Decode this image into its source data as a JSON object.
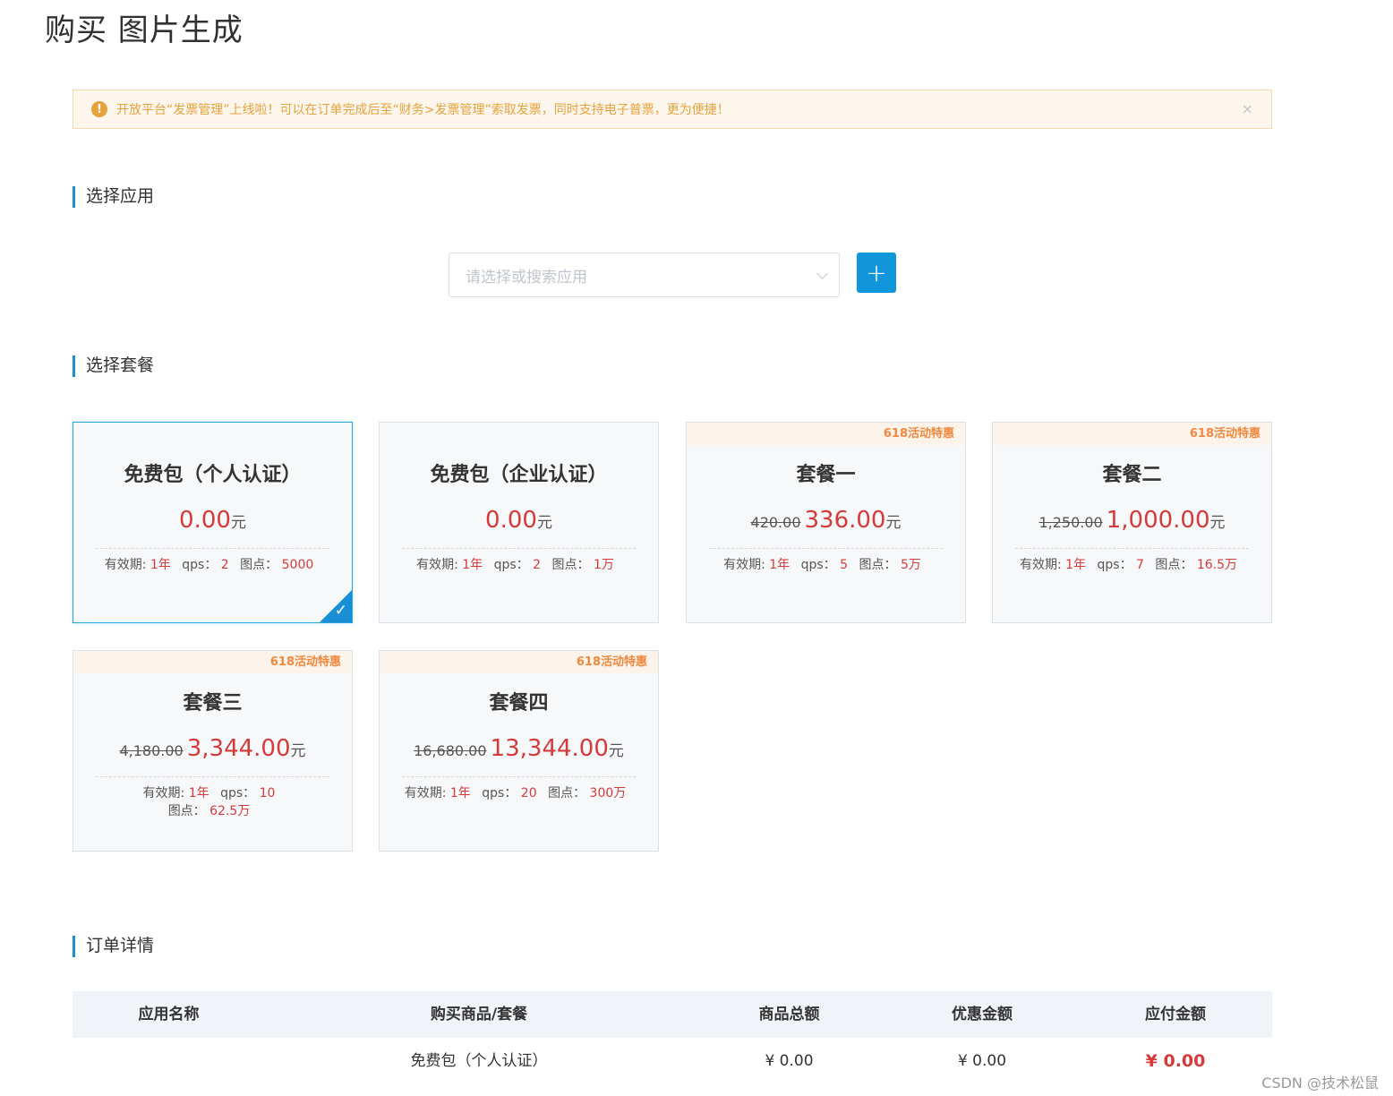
{
  "page": {
    "title": "购买 图片生成"
  },
  "alert": {
    "icon": "exclamation-circle-icon",
    "text": "开放平台“发票管理”上线啦！可以在订单完成后至“财务>发票管理”索取发票，同时支持电子普票，更为便捷！",
    "close": "×"
  },
  "sections": {
    "app": "选择应用",
    "package": "选择套餐",
    "order": "订单详情"
  },
  "app_select": {
    "placeholder": "请选择或搜索应用",
    "add_button": "+"
  },
  "labels": {
    "validity": "有效期:",
    "qps": "qps：",
    "points": "图点：",
    "yuan": "元"
  },
  "packages": [
    {
      "name": "免费包（个人认证）",
      "badge": "",
      "old_price": "",
      "price": "0.00",
      "validity": "1年",
      "qps": "2",
      "points": "5000",
      "selected": true
    },
    {
      "name": "免费包（企业认证）",
      "badge": "",
      "old_price": "",
      "price": "0.00",
      "validity": "1年",
      "qps": "2",
      "points": "1万",
      "selected": false
    },
    {
      "name": "套餐一",
      "badge": "618活动特惠",
      "old_price": "420.00",
      "price": "336.00",
      "validity": "1年",
      "qps": "5",
      "points": "5万",
      "selected": false
    },
    {
      "name": "套餐二",
      "badge": "618活动特惠",
      "old_price": "1,250.00",
      "price": "1,000.00",
      "validity": "1年",
      "qps": "7",
      "points": "16.5万",
      "selected": false
    },
    {
      "name": "套餐三",
      "badge": "618活动特惠",
      "old_price": "4,180.00",
      "price": "3,344.00",
      "validity": "1年",
      "qps": "10",
      "points": "62.5万",
      "selected": false
    },
    {
      "name": "套餐四",
      "badge": "618活动特惠",
      "old_price": "16,680.00",
      "price": "13,344.00",
      "validity": "1年",
      "qps": "20",
      "points": "300万",
      "selected": false
    }
  ],
  "order_table": {
    "headers": [
      "应用名称",
      "购买商品/套餐",
      "商品总额",
      "优惠金额",
      "应付金额"
    ],
    "row": [
      "",
      "免费包（个人认证）",
      "¥ 0.00",
      "¥ 0.00",
      "¥ 0.00"
    ]
  },
  "watermark": "CSDN @技术松鼠",
  "colors": {
    "accent": "#1296db",
    "price": "#d53a3a",
    "badge": "#f0883e",
    "alert": "#e6a23c"
  }
}
